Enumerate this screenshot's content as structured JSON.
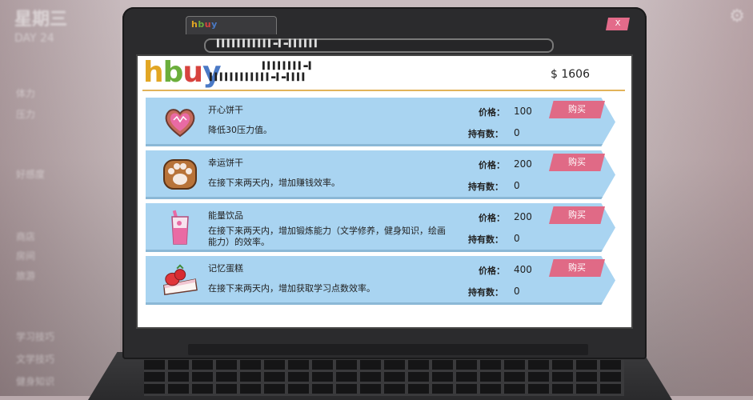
{
  "background": {
    "day": "星期三",
    "date": "DAY 24",
    "menu": [
      "体力",
      "压力",
      "好感度",
      "商店",
      "房间",
      "旅游",
      "学习技巧",
      "文学技巧",
      "健身知识"
    ]
  },
  "browser": {
    "tab_title": [
      "h",
      "b",
      "u",
      "y"
    ],
    "close_label": "X",
    "url": "▌▌▌▌▌▌▌▌▌▌▌▬▌▬▌▌▌▌▌▌"
  },
  "site": {
    "logo": [
      "h",
      "b",
      "u",
      "y"
    ],
    "code_line1": "▌▌▌▌▌▌▌▌▬▌",
    "code_line2": "▌▌▌▌▌▌▌▌▌▌▌▌▬▌▬▌▌▌▌",
    "money": "$ 1606"
  },
  "labels": {
    "price": "价格：",
    "owned": "持有数：",
    "buy": "购买"
  },
  "items": [
    {
      "name": "开心饼干",
      "desc": "降低30压力值。",
      "price": "100",
      "owned": "0",
      "icon": "heart-cookie-icon"
    },
    {
      "name": "幸运饼干",
      "desc": "在接下来两天内，增加赚钱效率。",
      "price": "200",
      "owned": "0",
      "icon": "paw-cookie-icon"
    },
    {
      "name": "能量饮品",
      "desc": "在接下来两天内，增加锻炼能力（文学修养，健身知识，绘画能力）的效率。",
      "price": "200",
      "owned": "0",
      "icon": "drink-icon"
    },
    {
      "name": "记忆蛋糕",
      "desc": "在接下来两天内，增加获取学习点数效率。",
      "price": "400",
      "owned": "0",
      "icon": "cake-icon"
    }
  ],
  "colors": {
    "item_bg": "#a9d4f1",
    "buy_button": "#e06a86",
    "header_line": "#e2b35a"
  }
}
